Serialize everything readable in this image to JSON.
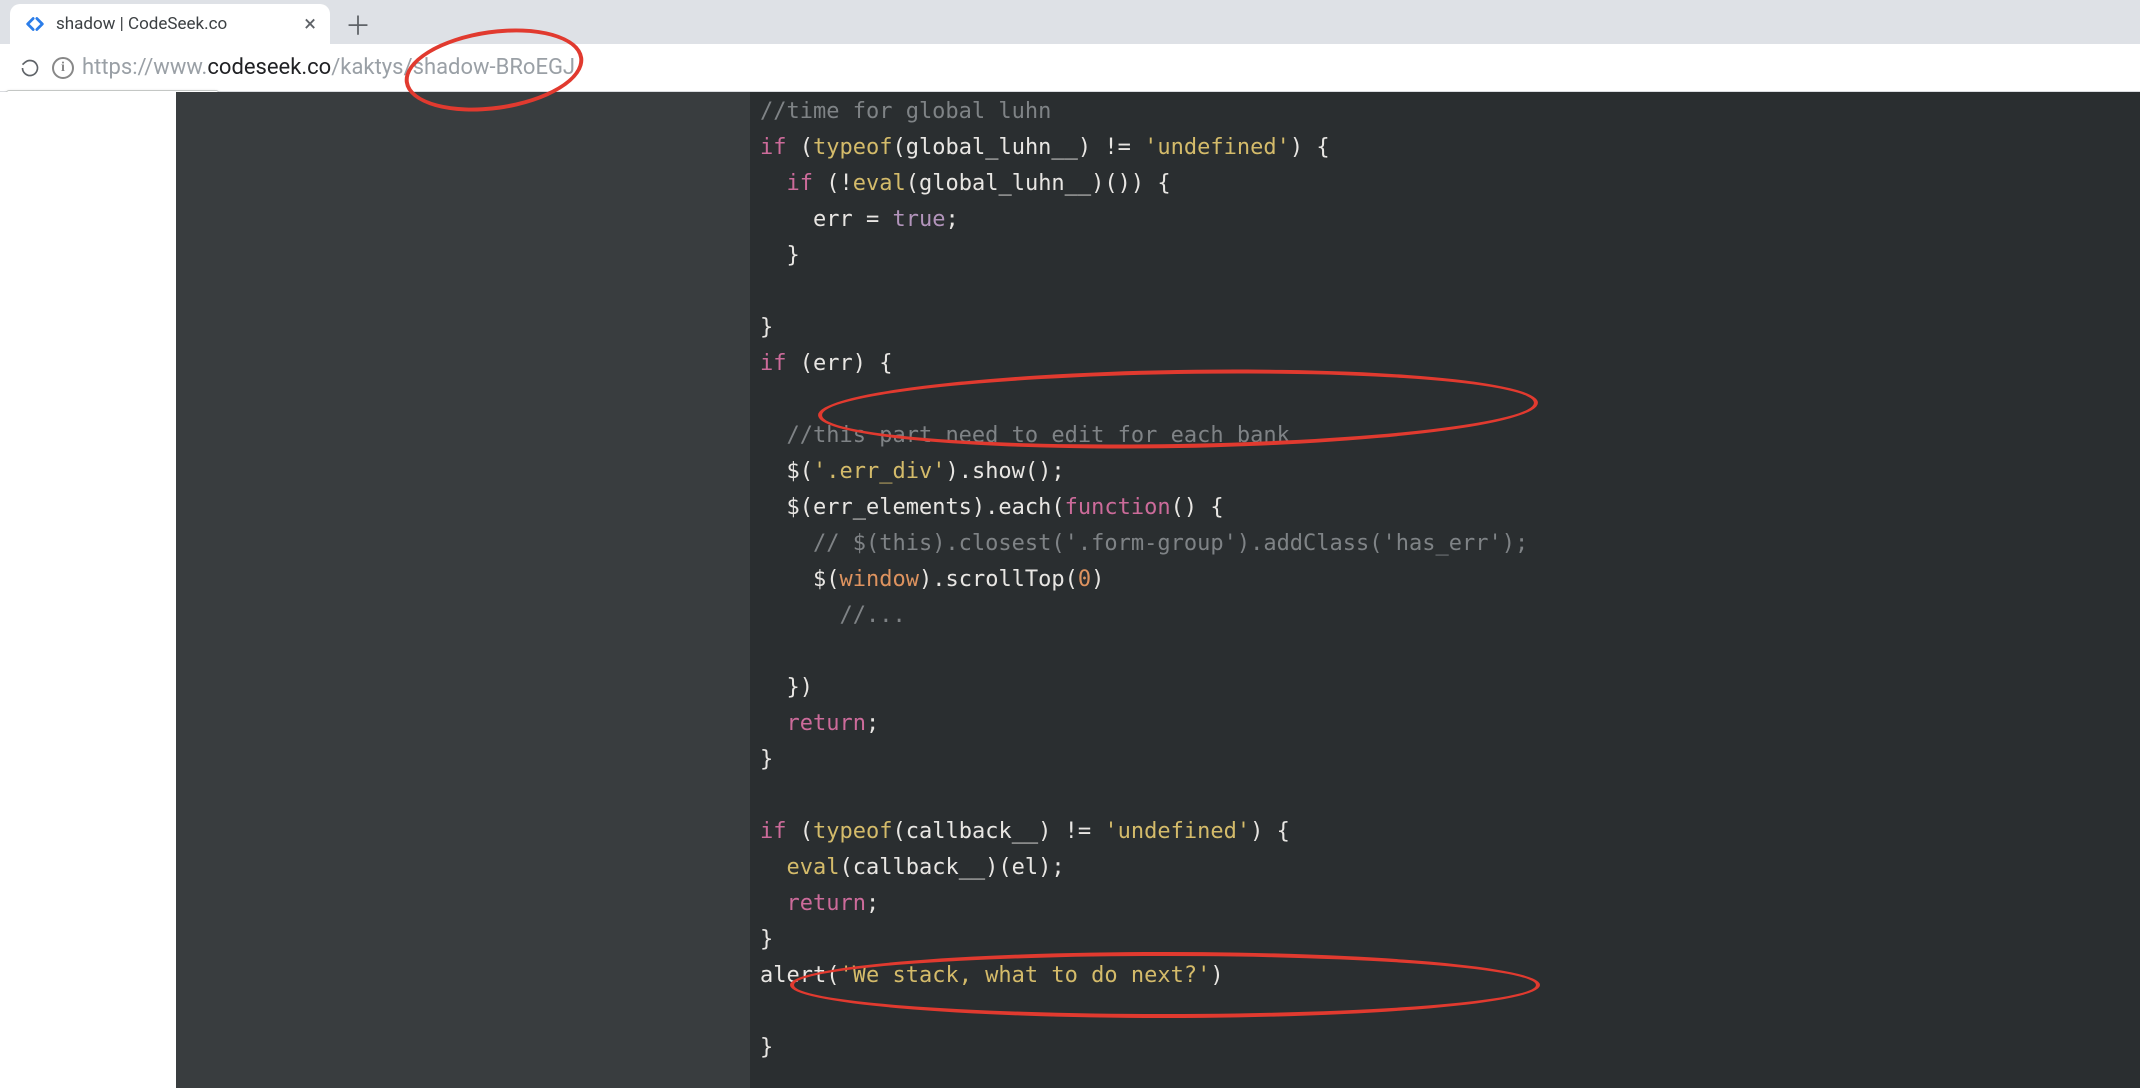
{
  "browser": {
    "tab_title": "shadow | CodeSeek.co",
    "status_tooltip": "shadow | CodeSeek.co",
    "new_tab_glyph": "＋",
    "close_glyph": "×",
    "info_glyph": "i",
    "url": {
      "scheme": "https://",
      "sub": "www.",
      "host": "codeseek.co",
      "path_prefix": "/kaktys/sha",
      "path_mid": "d",
      "path_suffix": "ow-BRoEGJ"
    }
  },
  "code": {
    "l01a": "//time for global luhn",
    "l02_if": "if",
    "l02_typeof": "typeof",
    "l02_id": "global_luhn__",
    "l02_ne": " != ",
    "l02_str": "'undefined'",
    "l03_if": "if",
    "l03_bang": "!",
    "l03_eval": "eval",
    "l03_id": "global_luhn__",
    "l04_err": "err = ",
    "l04_true": "true",
    "l04_semi": ";",
    "l05": "}",
    "l06": "",
    "l07": "}",
    "l08_if": "if",
    "l08_err": " (err) {",
    "l09": "",
    "l10_cmt": "//this part need to edit for each bank",
    "l11_a": "$(",
    "l11_str": "'.err_div'",
    "l11_b": ").show();",
    "l12_a": "$(err_elements).each(",
    "l12_fn": "function",
    "l12_b": "() {",
    "l13_cmt": "// $(this).closest('.form-group').addClass('has_err');",
    "l14_a": "$(",
    "l14_win": "window",
    "l14_b": ").scrollTop(",
    "l14_num": "0",
    "l14_c": ")",
    "l15_cmt": "//...",
    "l16": "",
    "l17": "})",
    "l18_ret": "return",
    "l18_semi": ";",
    "l19": "}",
    "l20": "",
    "l21_if": "if",
    "l21_a": " (",
    "l21_typeof": "typeof",
    "l21_b": "(callback__) != ",
    "l21_str": "'undefined'",
    "l21_c": ") {",
    "l22_eval": "eval",
    "l22_a": "(callback__)(el);",
    "l23_ret": "return",
    "l23_semi": ";",
    "l24": "}",
    "l25_a": "alert(",
    "l25_str": "'We stack, what to do next?'",
    "l25_b": ")",
    "l26": "",
    "l27": "}"
  }
}
